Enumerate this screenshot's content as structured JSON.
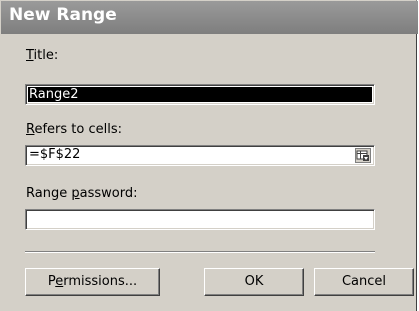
{
  "dialog": {
    "title": "New Range"
  },
  "fields": {
    "title_label_mnemonic": "T",
    "title_label_rest": "itle:",
    "title_value": "Range2",
    "refers_label_mnemonic": "R",
    "refers_label_rest": "efers to cells:",
    "refers_value": "=$F$22",
    "password_label_pre": "Range ",
    "password_label_mnemonic": "p",
    "password_label_rest": "assword:",
    "password_value": ""
  },
  "buttons": {
    "permissions_pre": "P",
    "permissions_mnemonic": "e",
    "permissions_rest": "rmissions...",
    "ok": "OK",
    "cancel": "Cancel"
  },
  "colors": {
    "dialog_face": "#d4d0c8",
    "titlebar": "#8c8c8c",
    "title_text": "#ffffff",
    "selection": "#000000"
  },
  "icons": {
    "collapse": "range-collapse-icon"
  }
}
